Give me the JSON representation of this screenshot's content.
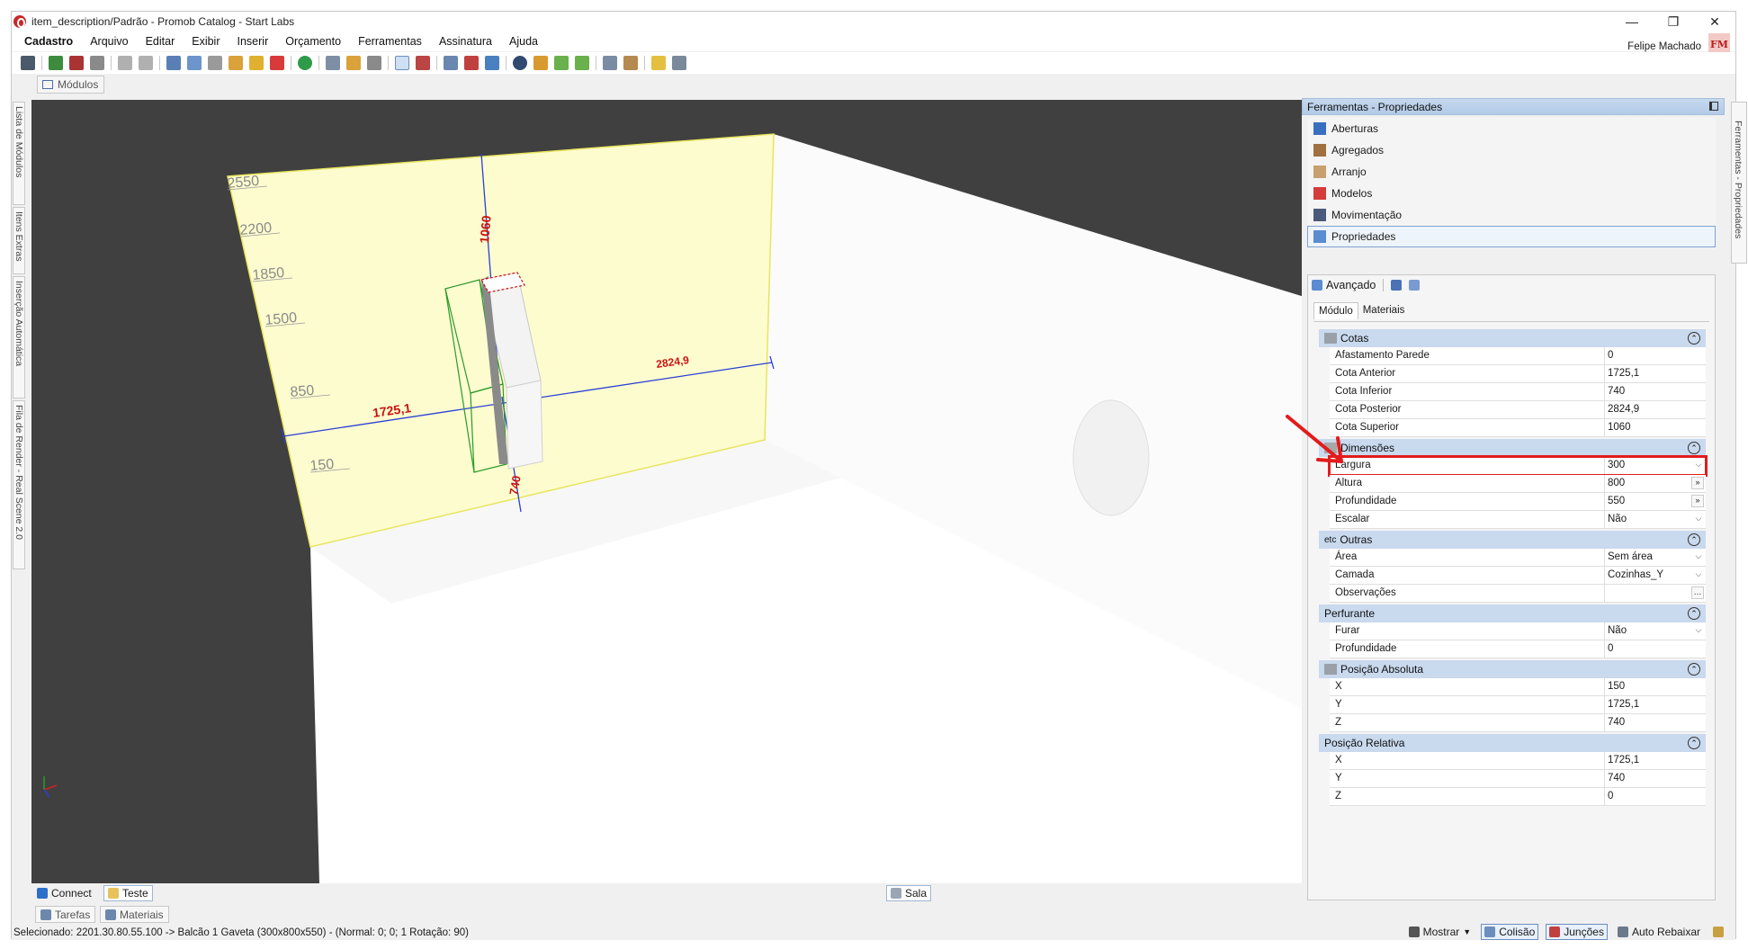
{
  "window": {
    "title": "item_description/Padrão - Promob Catalog - Start Labs",
    "minimize": "—",
    "restore": "❐",
    "close": "✕"
  },
  "menu": {
    "items": [
      "Cadastro",
      "Arquivo",
      "Editar",
      "Exibir",
      "Inserir",
      "Orçamento",
      "Ferramentas",
      "Assinatura",
      "Ajuda"
    ],
    "user_name": "Felipe Machado",
    "avatar_initials": "FM"
  },
  "doc_tab": {
    "label": "Módulos"
  },
  "left_side_tabs": [
    "Lista de Módulos",
    "Itens Extras",
    "Inserção Automática",
    "Fila de Render - Real Scene 2.0"
  ],
  "right_side_tab": "Ferramentas - Propriedades",
  "viewport": {
    "wall_labels": [
      "2550",
      "2200",
      "1850",
      "1500",
      "850",
      "150"
    ],
    "dimensions": {
      "top": "1060",
      "left": "1725,1",
      "right": "2824,9",
      "bottom": "740"
    }
  },
  "vp_bottom": {
    "connect": "Connect",
    "teste": "Teste",
    "sala": "Sala"
  },
  "panel_tabs": {
    "tarefas": "Tarefas",
    "materiais": "Materiais"
  },
  "status": {
    "text": "Selecionado: 2201.30.80.55.100 -> Balcão 1 Gaveta (300x800x550) - (Normal: 0; 0; 1 Rotação: 90)",
    "mostrar": "Mostrar",
    "colisao": "Colisão",
    "juncoes": "Junções",
    "auto_rebaixar": "Auto Rebaixar"
  },
  "props": {
    "header": "Ferramentas - Propriedades",
    "tools": [
      "Aberturas",
      "Agregados",
      "Arranjo",
      "Modelos",
      "Movimentação",
      "Propriedades"
    ],
    "selected_tool": "Propriedades",
    "advanced_label": "Avançado",
    "tabs": [
      "Módulo",
      "Materiais"
    ],
    "categories": [
      {
        "name": "Cotas",
        "rows": [
          {
            "name": "Afastamento Parede",
            "value": "0"
          },
          {
            "name": "Cota Anterior",
            "value": "1725,1"
          },
          {
            "name": "Cota Inferior",
            "value": "740"
          },
          {
            "name": "Cota Posterior",
            "value": "2824,9"
          },
          {
            "name": "Cota Superior",
            "value": "1060"
          }
        ]
      },
      {
        "name": "Dimensões",
        "rows": [
          {
            "name": "Largura",
            "value": "300"
          },
          {
            "name": "Altura",
            "value": "800"
          },
          {
            "name": "Profundidade",
            "value": "550"
          },
          {
            "name": "Escalar",
            "value": "Não"
          }
        ]
      },
      {
        "name": "Outras",
        "rows": [
          {
            "name": "Área",
            "value": "Sem área"
          },
          {
            "name": "Camada",
            "value": "Cozinhas_Y"
          },
          {
            "name": "Observações",
            "value": ""
          }
        ]
      },
      {
        "name": "Perfurante",
        "rows": [
          {
            "name": "Furar",
            "value": "Não"
          },
          {
            "name": "Profundidade",
            "value": "0"
          }
        ]
      },
      {
        "name": "Posição Absoluta",
        "rows": [
          {
            "name": "X",
            "value": "150"
          },
          {
            "name": "Y",
            "value": "1725,1"
          },
          {
            "name": "Z",
            "value": "740"
          }
        ]
      },
      {
        "name": "Posição Relativa",
        "rows": [
          {
            "name": "X",
            "value": "1725,1"
          },
          {
            "name": "Y",
            "value": "740"
          },
          {
            "name": "Z",
            "value": "0"
          }
        ]
      }
    ],
    "outras_icon_text": "etc"
  },
  "colors": {
    "accent_red": "#e31b1b",
    "wall_yellow": "#fdfccf",
    "dim_blue": "#2a3fd6",
    "dim_red": "#cc1111",
    "category_blue": "#c9d9ee"
  }
}
